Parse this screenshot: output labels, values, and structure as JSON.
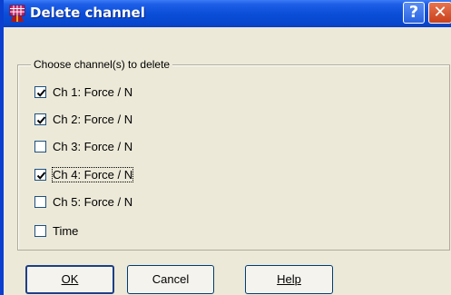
{
  "window": {
    "title": "Delete channel",
    "help_glyph": "?",
    "close_glyph": "✕",
    "title_icon": "grid-app-icon"
  },
  "group": {
    "label": "Choose channel(s) to delete"
  },
  "channels": [
    {
      "label": "Ch 1: Force / N",
      "checked": true
    },
    {
      "label": "Ch 2: Force / N",
      "checked": true
    },
    {
      "label": "Ch 3: Force / N",
      "checked": false
    },
    {
      "label": "Ch 4: Force / N",
      "checked": true,
      "focused": true
    },
    {
      "label": "Ch 5: Force / N",
      "checked": false
    },
    {
      "label": "Time",
      "checked": false
    }
  ],
  "buttons": {
    "ok_label": "OK",
    "cancel_label": "Cancel",
    "help_label": "Help"
  },
  "colors": {
    "titlebar": "#0b4ed8",
    "dialog_bg": "#ece9d8",
    "checkbox_border": "#1c5180"
  }
}
